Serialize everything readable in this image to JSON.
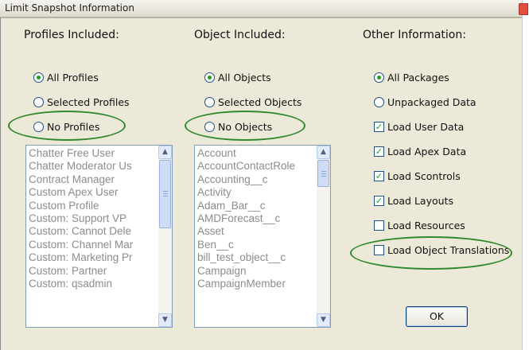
{
  "window": {
    "title": "Limit Snapshot Information"
  },
  "profiles": {
    "heading": "Profiles Included:",
    "options": [
      "All Profiles",
      "Selected Profiles",
      "No Profiles"
    ],
    "selected": "All Profiles",
    "list": [
      "Chatter Free User",
      "Chatter Moderator Us",
      "Contract Manager",
      "Custom Apex User",
      "Custom Profile",
      "Custom:  Support VP",
      "Custom: Cannot Dele",
      "Custom: Channel Mar",
      "Custom: Marketing Pr",
      "Custom: Partner",
      "Custom: qsadmin"
    ]
  },
  "objects": {
    "heading": "Object Included:",
    "options": [
      "All Objects",
      "Selected Objects",
      "No Objects"
    ],
    "selected": "All Objects",
    "list": [
      "Account",
      "AccountContactRole",
      "Accounting__c",
      "Activity",
      "Adam_Bar__c",
      "AMDForecast__c",
      "Asset",
      "Ben__c",
      "bill_test_object__c",
      "Campaign",
      "CampaignMember"
    ]
  },
  "other": {
    "heading": "Other Information:",
    "radios": [
      "All Packages",
      "Unpackaged Data"
    ],
    "selected": "All Packages",
    "checkboxes": [
      {
        "label": "Load User Data",
        "checked": true
      },
      {
        "label": "Load Apex Data",
        "checked": true
      },
      {
        "label": "Load Scontrols",
        "checked": true
      },
      {
        "label": "Load Layouts",
        "checked": true
      },
      {
        "label": "Load Resources",
        "checked": false
      },
      {
        "label": "Load Object Translations",
        "checked": false
      }
    ]
  },
  "buttons": {
    "ok": "OK"
  },
  "icons": {
    "close": "close-icon",
    "scroll_up": "chevron-up-icon",
    "scroll_down": "chevron-down-icon"
  },
  "colors": {
    "highlight_oval": "#2f8a2f",
    "dialog_bg": "#ece9d8",
    "list_text": "#8c8c8c"
  }
}
